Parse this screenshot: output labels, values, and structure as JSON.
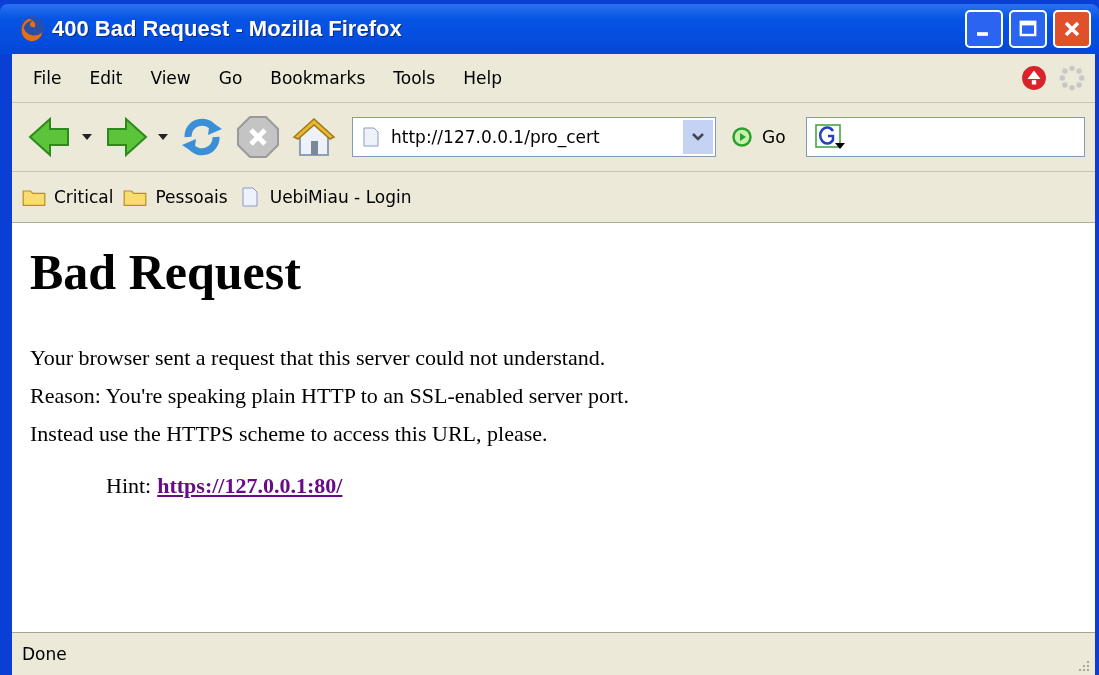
{
  "window": {
    "title": "400 Bad Request - Mozilla Firefox"
  },
  "menu": [
    "File",
    "Edit",
    "View",
    "Go",
    "Bookmarks",
    "Tools",
    "Help"
  ],
  "toolbar": {
    "url": "http://127.0.0.1/pro_cert",
    "go_label": "Go"
  },
  "bookmarks": [
    {
      "kind": "folder",
      "label": "Critical"
    },
    {
      "kind": "folder",
      "label": "Pessoais"
    },
    {
      "kind": "page",
      "label": "UebiMiau - Login"
    }
  ],
  "page": {
    "heading": "Bad Request",
    "lines": [
      "Your browser sent a request that this server could not understand.",
      "Reason: You're speaking plain HTTP to an SSL-enabled server port.",
      "Instead use the HTTPS scheme to access this URL, please."
    ],
    "hint_label": "Hint:",
    "hint_link": "https://127.0.0.1:80/"
  },
  "status_bar": {
    "text": "Done"
  }
}
